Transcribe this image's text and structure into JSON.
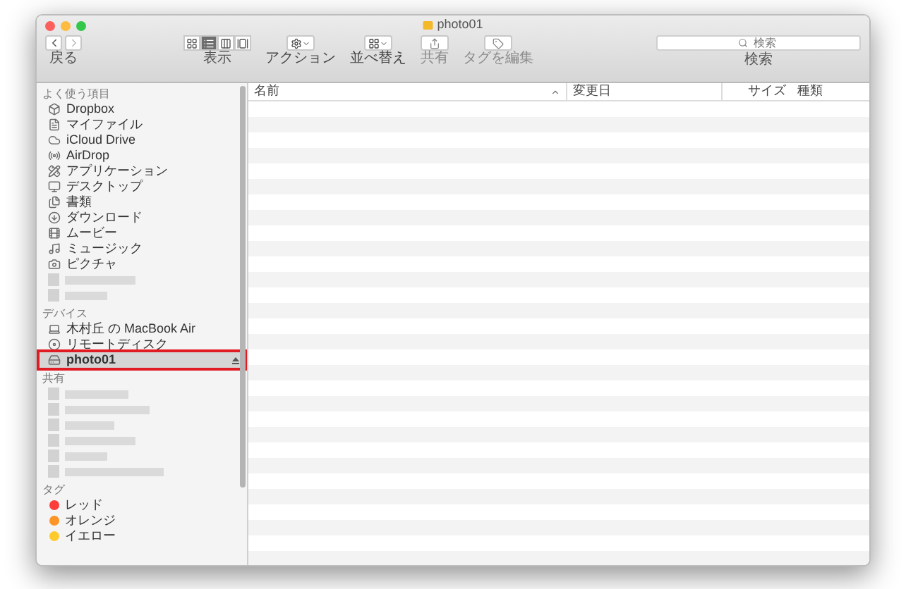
{
  "window": {
    "title": "photo01"
  },
  "toolbar": {
    "back_label": "戻る",
    "back_disabled": false,
    "forward_disabled": true,
    "view": {
      "label": "表示",
      "modes": [
        {
          "kind": "icons",
          "selected": false
        },
        {
          "kind": "list",
          "selected": true
        },
        {
          "kind": "columns",
          "selected": false
        },
        {
          "kind": "cover",
          "selected": false
        }
      ]
    },
    "groups": [
      {
        "kind": "action",
        "label": "アクション",
        "disabled": false
      },
      {
        "kind": "arrange",
        "label": "並べ替え",
        "disabled": false
      },
      {
        "kind": "share",
        "label": "共有",
        "disabled": true
      },
      {
        "kind": "tag",
        "label": "タグを編集",
        "disabled": true
      }
    ],
    "search": {
      "placeholder": "検索",
      "label": "検索"
    }
  },
  "sidebar": {
    "sections": [
      {
        "title": "よく使う項目",
        "items": [
          {
            "kind": "dropbox",
            "label": "Dropbox",
            "selected": false
          },
          {
            "kind": "myfiles",
            "label": "マイファイル",
            "selected": false
          },
          {
            "kind": "icloud",
            "label": "iCloud Drive",
            "selected": false
          },
          {
            "kind": "airdrop",
            "label": "AirDrop",
            "selected": false
          },
          {
            "kind": "apps",
            "label": "アプリケーション",
            "selected": false
          },
          {
            "kind": "desktop",
            "label": "デスクトップ",
            "selected": false
          },
          {
            "kind": "documents",
            "label": "書類",
            "selected": false
          },
          {
            "kind": "downloads",
            "label": "ダウンロード",
            "selected": false
          },
          {
            "kind": "movies",
            "label": "ムービー",
            "selected": false
          },
          {
            "kind": "music",
            "label": "ミュージック",
            "selected": false
          },
          {
            "kind": "pictures",
            "label": "ピクチャ",
            "selected": false
          },
          {
            "kind": "blurred",
            "selected": false
          },
          {
            "kind": "blurred",
            "selected": false
          }
        ]
      },
      {
        "title": "デバイス",
        "items": [
          {
            "kind": "laptop",
            "label": "木村丘 の MacBook Air",
            "selected": false
          },
          {
            "kind": "disc",
            "label": "リモートディスク",
            "selected": false
          },
          {
            "kind": "drive",
            "label": "photo01",
            "selected": true,
            "highlighted": true,
            "ejectable": true
          }
        ]
      },
      {
        "title": "共有",
        "items": [
          {
            "kind": "blurred",
            "selected": false
          },
          {
            "kind": "blurred",
            "selected": false
          },
          {
            "kind": "blurred",
            "selected": false
          },
          {
            "kind": "blurred",
            "selected": false
          },
          {
            "kind": "blurred",
            "selected": false
          },
          {
            "kind": "blurred",
            "selected": false
          }
        ]
      },
      {
        "title": "タグ",
        "items": [
          {
            "kind": "tag",
            "label": "レッド",
            "color": "#fc3d39",
            "selected": false
          },
          {
            "kind": "tag",
            "label": "オレンジ",
            "color": "#fd9426",
            "selected": false
          },
          {
            "kind": "tag",
            "label": "イエロー",
            "color": "#fecb2f",
            "selected": false
          }
        ]
      }
    ]
  },
  "table": {
    "columns": [
      {
        "label": "名前",
        "sorted": true
      },
      {
        "label": "変更日",
        "sorted": false
      },
      {
        "label": "サイズ",
        "sorted": false
      },
      {
        "label": "種類",
        "sorted": false
      }
    ]
  }
}
